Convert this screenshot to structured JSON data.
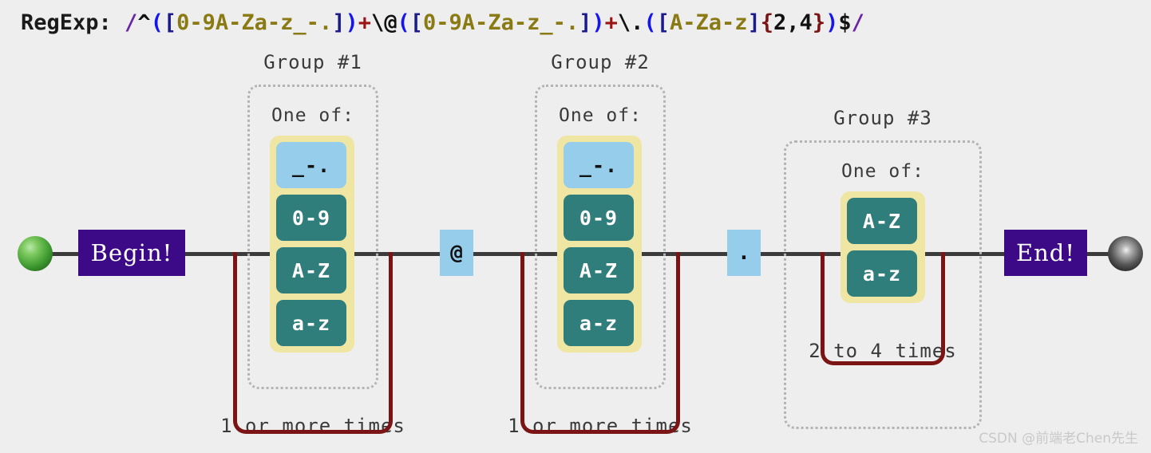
{
  "header": {
    "label": "RegExp: ",
    "tokens": [
      {
        "t": "/",
        "c": "#6a22a8"
      },
      {
        "t": "^",
        "c": "#111111"
      },
      {
        "t": "(",
        "c": "#1515ee"
      },
      {
        "t": "[",
        "c": "#1a1a8c"
      },
      {
        "t": "0-9A-Za-z_-.",
        "c": "#8a7a14"
      },
      {
        "t": "]",
        "c": "#1a1a8c"
      },
      {
        "t": ")",
        "c": "#1515ee"
      },
      {
        "t": "+",
        "c": "#9c1414"
      },
      {
        "t": "\\@",
        "c": "#111111"
      },
      {
        "t": "(",
        "c": "#1515ee"
      },
      {
        "t": "[",
        "c": "#1a1a8c"
      },
      {
        "t": "0-9A-Za-z_-.",
        "c": "#8a7a14"
      },
      {
        "t": "]",
        "c": "#1a1a8c"
      },
      {
        "t": ")",
        "c": "#1515ee"
      },
      {
        "t": "+",
        "c": "#9c1414"
      },
      {
        "t": "\\.",
        "c": "#111111"
      },
      {
        "t": "(",
        "c": "#1515ee"
      },
      {
        "t": "[",
        "c": "#1a1a8c"
      },
      {
        "t": "A-Za-z",
        "c": "#8a7a14"
      },
      {
        "t": "]",
        "c": "#1a1a8c"
      },
      {
        "t": "{",
        "c": "#7b1515"
      },
      {
        "t": "2,4",
        "c": "#111111"
      },
      {
        "t": "}",
        "c": "#7b1515"
      },
      {
        "t": ")",
        "c": "#1515ee"
      },
      {
        "t": "$",
        "c": "#111111"
      },
      {
        "t": "/",
        "c": "#6a22a8"
      }
    ],
    "full_pattern": "/^([0-9A-Za-z_-.])+\\@([0-9A-Za-z_-.])+\\.([A-Za-z]{2,4})$/"
  },
  "terminals": {
    "begin_label": "Begin!",
    "end_label": "End!"
  },
  "groups": [
    {
      "title": "Group #1",
      "one_of_label": "One of:",
      "alternatives": [
        {
          "text": "_-.",
          "kind": "literal"
        },
        {
          "text": "0-9",
          "kind": "range"
        },
        {
          "text": "A-Z",
          "kind": "range"
        },
        {
          "text": "a-z",
          "kind": "range"
        }
      ],
      "repetition": "1 or more times"
    },
    {
      "title": "Group #2",
      "one_of_label": "One of:",
      "alternatives": [
        {
          "text": "_-.",
          "kind": "literal"
        },
        {
          "text": "0-9",
          "kind": "range"
        },
        {
          "text": "A-Z",
          "kind": "range"
        },
        {
          "text": "a-z",
          "kind": "range"
        }
      ],
      "repetition": "1 or more times"
    },
    {
      "title": "Group #3",
      "one_of_label": "One of:",
      "alternatives": [
        {
          "text": "A-Z",
          "kind": "range"
        },
        {
          "text": "a-z",
          "kind": "range"
        }
      ],
      "repetition": "2 to 4 times"
    }
  ],
  "literals": [
    {
      "text": "@"
    },
    {
      "text": "."
    }
  ],
  "watermark": "CSDN @前端老Chen先生",
  "colors": {
    "background": "#eeeeee",
    "rail": "#3b3b3b",
    "terminal_purple": "#3d0a87",
    "range_teal": "#2f7e7b",
    "literal_blue": "#95cdea",
    "alt_yellow": "#efe6a4",
    "loop_red": "#7b1515",
    "group_dotted": "#b4b4b4"
  }
}
